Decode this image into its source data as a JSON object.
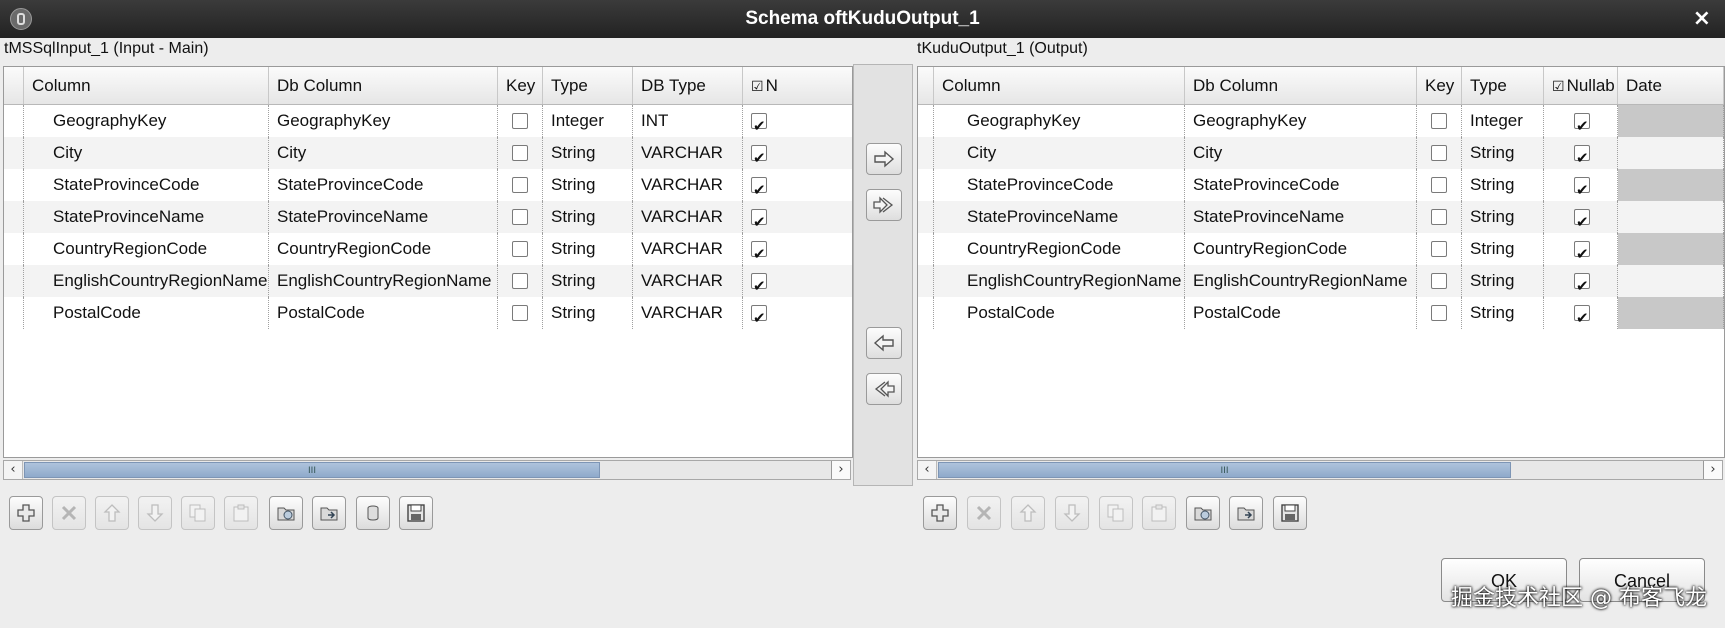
{
  "window": {
    "title": "Schema oftKuduOutput_1",
    "close_symbol": "×"
  },
  "left": {
    "title": "tMSSqlInput_1 (Input - Main)",
    "columns": [
      "Column",
      "Db Column",
      "Key",
      "Type",
      "DB Type",
      "N"
    ],
    "rows": [
      {
        "column": "GeographyKey",
        "db_column": "GeographyKey",
        "key": false,
        "type": "Integer",
        "db_type": "INT",
        "nullable": true
      },
      {
        "column": "City",
        "db_column": "City",
        "key": false,
        "type": "String",
        "db_type": "VARCHAR",
        "nullable": true
      },
      {
        "column": "StateProvinceCode",
        "db_column": "StateProvinceCode",
        "key": false,
        "type": "String",
        "db_type": "VARCHAR",
        "nullable": true
      },
      {
        "column": "StateProvinceName",
        "db_column": "StateProvinceName",
        "key": false,
        "type": "String",
        "db_type": "VARCHAR",
        "nullable": true
      },
      {
        "column": "CountryRegionCode",
        "db_column": "CountryRegionCode",
        "key": false,
        "type": "String",
        "db_type": "VARCHAR",
        "nullable": true
      },
      {
        "column": "EnglishCountryRegionName",
        "db_column": "EnglishCountryRegionName",
        "key": false,
        "type": "String",
        "db_type": "VARCHAR",
        "nullable": true
      },
      {
        "column": "PostalCode",
        "db_column": "PostalCode",
        "key": false,
        "type": "String",
        "db_type": "VARCHAR",
        "nullable": true
      }
    ],
    "scroll_grip": "III"
  },
  "right": {
    "title": "tKuduOutput_1 (Output)",
    "columns": [
      "Column",
      "Db Column",
      "Key",
      "Type",
      "Nullab",
      "Date"
    ],
    "rows": [
      {
        "column": "GeographyKey",
        "db_column": "GeographyKey",
        "key": false,
        "type": "Integer",
        "nullable": true
      },
      {
        "column": "City",
        "db_column": "City",
        "key": false,
        "type": "String",
        "nullable": true
      },
      {
        "column": "StateProvinceCode",
        "db_column": "StateProvinceCode",
        "key": false,
        "type": "String",
        "nullable": true
      },
      {
        "column": "StateProvinceName",
        "db_column": "StateProvinceName",
        "key": false,
        "type": "String",
        "nullable": true
      },
      {
        "column": "CountryRegionCode",
        "db_column": "CountryRegionCode",
        "key": false,
        "type": "String",
        "nullable": true
      },
      {
        "column": "EnglishCountryRegionName",
        "db_column": "EnglishCountryRegionName",
        "key": false,
        "type": "String",
        "nullable": true
      },
      {
        "column": "PostalCode",
        "db_column": "PostalCode",
        "key": false,
        "type": "String",
        "nullable": true
      }
    ],
    "scroll_grip": "III"
  },
  "header_check_symbol": "☑",
  "buttons": {
    "ok": "OK",
    "cancel": "Cancel"
  },
  "watermark": "掘金技术社区 @ 布客飞龙",
  "icons": {
    "left_toolbar": [
      "add-icon",
      "remove-icon",
      "move-up-icon",
      "move-down-icon",
      "copy-icon",
      "paste-icon",
      "import-icon",
      "export-icon",
      "db-icon",
      "save-icon"
    ],
    "right_toolbar": [
      "add-icon",
      "remove-icon",
      "move-up-icon",
      "move-down-icon",
      "copy-icon",
      "paste-icon",
      "import-icon",
      "export-icon",
      "save-icon"
    ],
    "transfer": [
      "copy-selected-right-icon",
      "copy-all-right-icon",
      "copy-selected-left-icon",
      "copy-all-left-icon"
    ]
  },
  "colors": {
    "titlebar": "#2b2b2b",
    "scroll_thumb": "#9cb6d4",
    "grid_bg": "#ffffff",
    "right_gray_column": "#c8c8c8"
  }
}
